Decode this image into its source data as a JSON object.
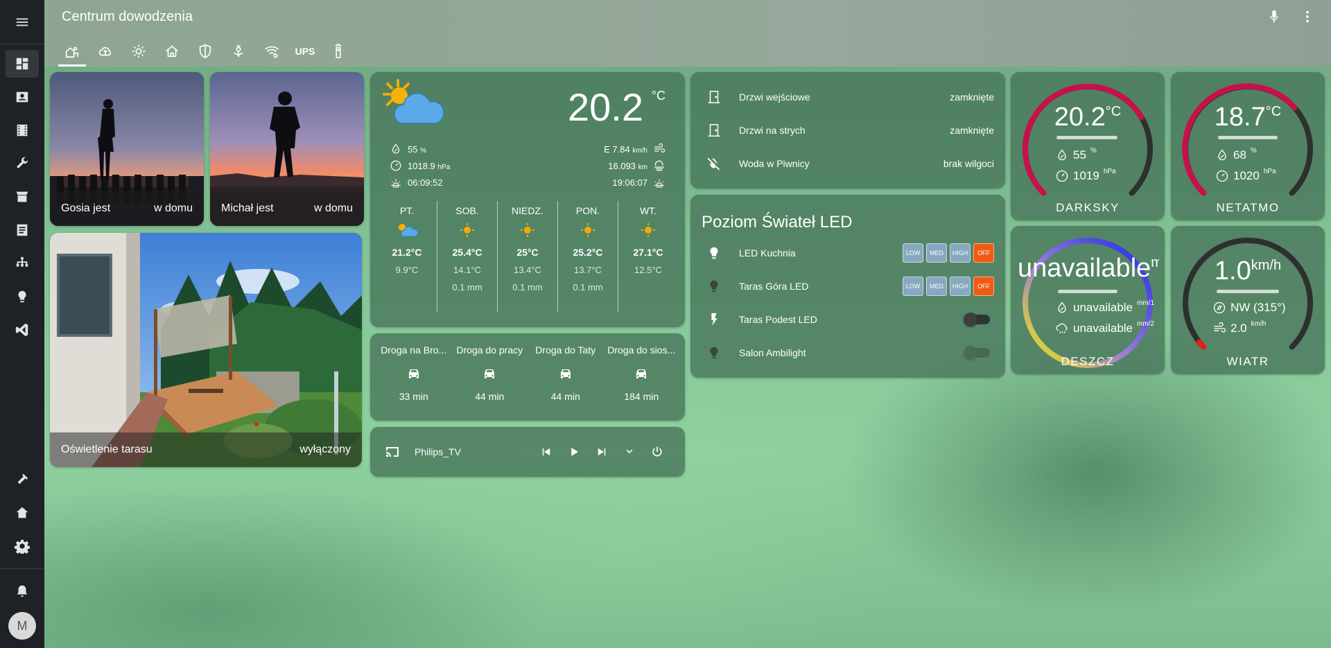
{
  "app_title": "Centrum dowodzenia",
  "avatar_initial": "M",
  "tabs": [
    {
      "icon": "home-garden-icon",
      "label": ""
    },
    {
      "icon": "cloud-upload-icon",
      "label": ""
    },
    {
      "icon": "sun-icon",
      "label": ""
    },
    {
      "icon": "home-group-icon",
      "label": ""
    },
    {
      "icon": "shield-icon",
      "label": ""
    },
    {
      "icon": "flower-icon",
      "label": ""
    },
    {
      "icon": "wifi-cog-icon",
      "label": ""
    },
    {
      "icon": "ups-label",
      "label": "UPS"
    },
    {
      "icon": "remote-icon",
      "label": ""
    }
  ],
  "persons": [
    {
      "name": "Gosia jest",
      "state": "w domu"
    },
    {
      "name": "Michał jest",
      "state": "w domu"
    }
  ],
  "camera": {
    "name": "Oświetlenie tarasu",
    "state": "wyłączony"
  },
  "weather": {
    "temperature": "20.2",
    "unit": "°C",
    "humidity": "55",
    "humidity_unit": "%",
    "pressure": "1018.9",
    "pressure_unit": "hPa",
    "sunrise": "06:09:52",
    "wind": "E 7.84",
    "wind_unit": "km/h",
    "visibility": "16.093",
    "visibility_unit": "km",
    "sunset": "19:06:07",
    "forecast": [
      {
        "day": "PT.",
        "icon": "partly-cloudy-icon",
        "high": "21.2°C",
        "low": "9.9°C",
        "precip": ""
      },
      {
        "day": "SOB.",
        "icon": "sunny-icon",
        "high": "25.4°C",
        "low": "14.1°C",
        "precip": "0.1 mm"
      },
      {
        "day": "NIEDZ.",
        "icon": "sunny-icon",
        "high": "25°C",
        "low": "13.4°C",
        "precip": "0.1 mm"
      },
      {
        "day": "PON.",
        "icon": "sunny-icon",
        "high": "25.2°C",
        "low": "13.7°C",
        "precip": "0.1 mm"
      },
      {
        "day": "WT.",
        "icon": "sunny-icon",
        "high": "27.1°C",
        "low": "12.5°C",
        "precip": ""
      }
    ]
  },
  "travel": [
    {
      "name": "Droga na Bro...",
      "time": "33 min"
    },
    {
      "name": "Droga do pracy",
      "time": "44 min"
    },
    {
      "name": "Droga do Taty",
      "time": "44 min"
    },
    {
      "name": "Droga do sios...",
      "time": "184 min"
    }
  ],
  "media": {
    "name": "Philips_TV"
  },
  "doors": [
    {
      "name": "Drzwi wejściowe",
      "state": "zamknięte",
      "icon": "door-closed-icon"
    },
    {
      "name": "Drzwi na strych",
      "state": "zamknięte",
      "icon": "door-closed-icon"
    },
    {
      "name": "Woda w Piwnicy",
      "state": "brak wilgoci",
      "icon": "water-off-icon"
    }
  ],
  "led": {
    "title": "Poziom Świateł LED",
    "buttons": [
      "LOW",
      "MED",
      "HIGH",
      "OFF"
    ],
    "items": [
      {
        "name": "LED Kuchnia",
        "icon": "bulb-on-icon",
        "control": "buttons"
      },
      {
        "name": "Taras Góra LED",
        "icon": "bulb-off-icon",
        "control": "buttons"
      },
      {
        "name": "Taras Podest LED",
        "icon": "flash-icon",
        "control": "toggle"
      },
      {
        "name": "Salon Ambilight",
        "icon": "bulb-off-icon",
        "control": "toggle-disabled"
      }
    ]
  },
  "gauges": {
    "darksky": {
      "name": "DARKSKY",
      "value": "20.2",
      "unit": "°C",
      "humidity": "55",
      "humidity_unit": "%",
      "pressure": "1019",
      "pressure_unit": "hPa",
      "level": 0.72,
      "color": "#c8104a"
    },
    "netatmo": {
      "name": "NETATMO",
      "value": "18.7",
      "unit": "°C",
      "humidity": "68",
      "humidity_unit": "%",
      "pressure": "1020",
      "pressure_unit": "hPa",
      "level": 0.68,
      "color": "#c8104a"
    },
    "deszcz": {
      "name": "DESZCZ",
      "value": "unavailable",
      "unit": "mm",
      "rate": "unavailable",
      "rate_unit": "mm/1",
      "total": "unavailable",
      "total_unit": "mm/2"
    },
    "wiatr": {
      "name": "WIATR",
      "value": "1.0",
      "unit": "km/h",
      "direction": "NW (315°)",
      "gust": "2.0",
      "gust_unit": "km/h",
      "level": 0.02,
      "color": "#e02020"
    }
  }
}
